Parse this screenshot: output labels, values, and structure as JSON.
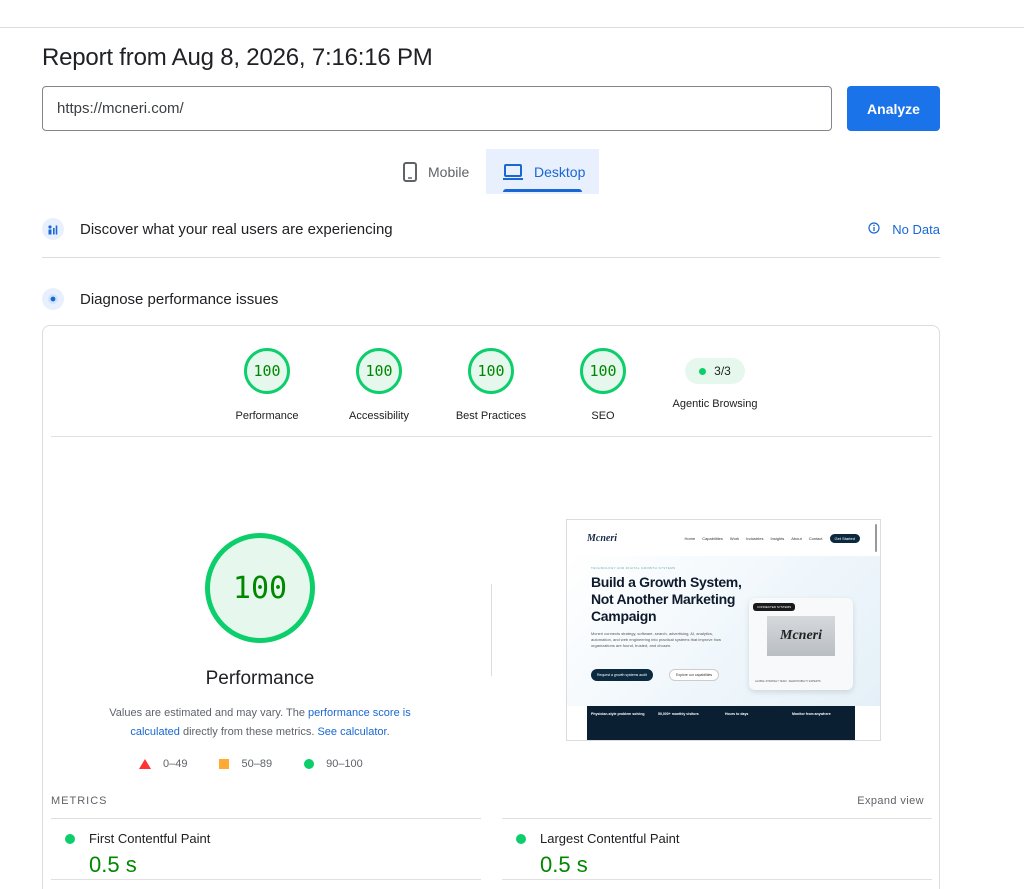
{
  "report": {
    "title": "Report from Aug 8, 2026, 7:16:16 PM"
  },
  "search": {
    "url_value": "https://mcneri.com/",
    "analyze_label": "Analyze"
  },
  "tabs": {
    "mobile": "Mobile",
    "desktop": "Desktop",
    "active": "Desktop"
  },
  "field_data": {
    "title": "Discover what your real users are experiencing",
    "status": "No Data"
  },
  "diagnose": {
    "title": "Diagnose performance issues"
  },
  "categories": [
    {
      "label": "Performance",
      "score": "100"
    },
    {
      "label": "Accessibility",
      "score": "100"
    },
    {
      "label": "Best Practices",
      "score": "100"
    },
    {
      "label": "SEO",
      "score": "100"
    },
    {
      "label": "Agentic Browsing",
      "score": "3/3"
    }
  ],
  "performance": {
    "score": "100",
    "label": "Performance",
    "explain_prefix": "Values are estimated and may vary. The ",
    "explain_link1": "performance score is calculated",
    "explain_mid": " directly from these metrics. ",
    "explain_link2": "See calculator",
    "explain_suffix": "."
  },
  "legend": {
    "poor": "0–49",
    "average": "50–89",
    "good": "90–100"
  },
  "colors": {
    "good": "#0cce6b",
    "average": "#ffaa33",
    "poor": "#ff3333",
    "accent": "#1a73e8"
  },
  "screenshot": {
    "logo": "Mcneri",
    "nav": [
      "Home",
      "Capabilities",
      "Work",
      "Industries",
      "Insights",
      "About",
      "Contact"
    ],
    "nav_cta": "Get Started",
    "kicker": "TECHNOLOGY AND DIGITAL GROWTH SYSTEMS",
    "headline": "Build a Growth System, Not Another Marketing Campaign",
    "body": "Mcneri connects strategy, software, search, advertising, AI, analytics, automation, and web engineering into practical systems that improve how organizations are found, trusted, and chosen.",
    "btn_primary": "Request a growth systems audit",
    "btn_secondary": "Explore our capabilities",
    "card_tag": "CONNECTED SYSTEMS",
    "card_caption": "GLOBAL STRATEGY TEAM · SEARCHABILITY EXPERTS",
    "strip": [
      "Physician-style problem solving",
      "50,000+ monthly visitors",
      "Hours to days",
      "Monitor from anywhere"
    ]
  },
  "metrics": {
    "header": "METRICS",
    "expand": "Expand view",
    "items": [
      {
        "name": "First Contentful Paint",
        "value": "0.5 s"
      },
      {
        "name": "Largest Contentful Paint",
        "value": "0.5 s"
      }
    ]
  }
}
